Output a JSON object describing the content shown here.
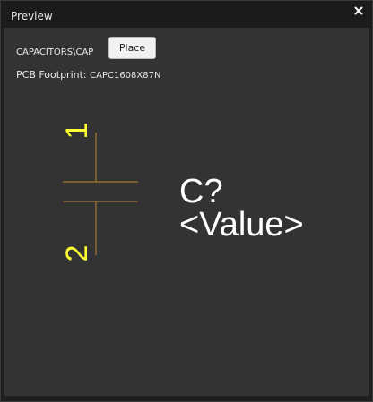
{
  "window": {
    "title": "Preview",
    "close_label": "×"
  },
  "header": {
    "library_path": "CAPACITORS\\CAP",
    "place_label": "Place",
    "footprint_label": "PCB Footprint:",
    "footprint_value": "CAPC1608X87N"
  },
  "symbol": {
    "pin1_number": "1",
    "pin2_number": "2",
    "designator": "C?",
    "value": "<Value>",
    "colors": {
      "pin_number": "#ffff33",
      "body_line": "#a4782c",
      "text": "#ffffff"
    }
  }
}
